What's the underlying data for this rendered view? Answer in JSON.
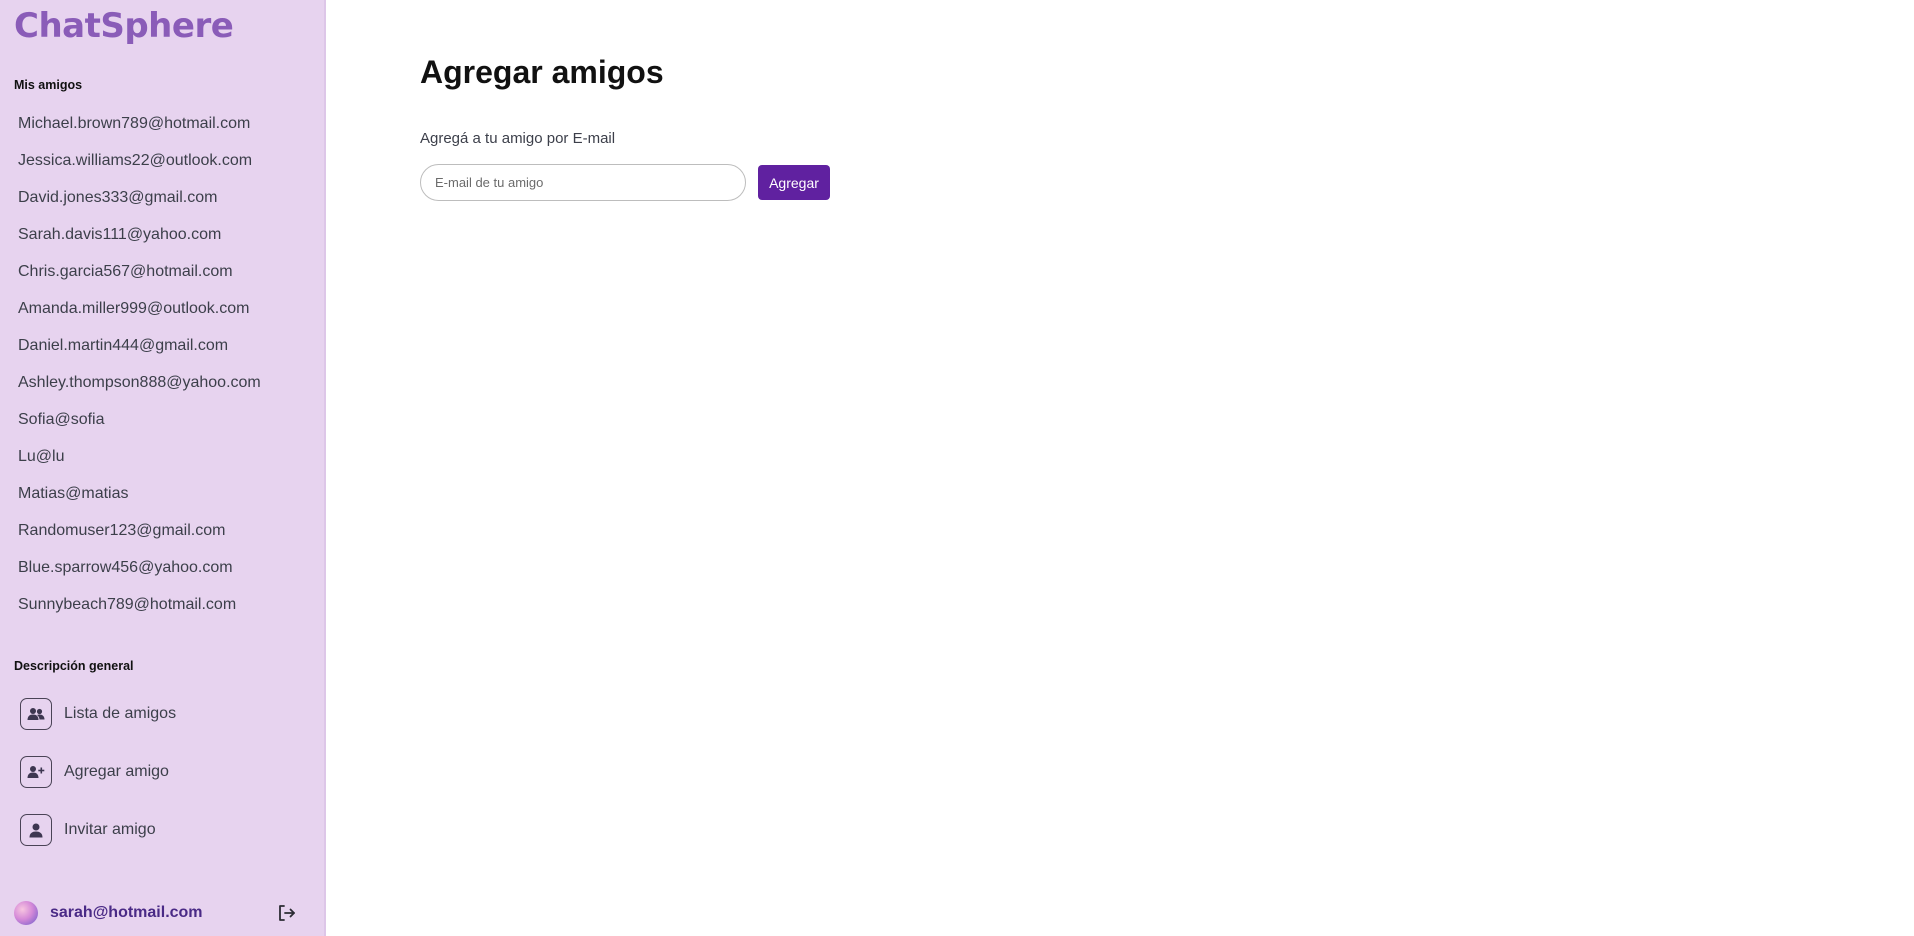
{
  "app": {
    "title": "ChatSphere"
  },
  "sidebar": {
    "friends_heading": "Mis amigos",
    "friends": [
      "Michael.brown789@hotmail.com",
      "Jessica.williams22@outlook.com",
      "David.jones333@gmail.com",
      "Sarah.davis111@yahoo.com",
      "Chris.garcia567@hotmail.com",
      "Amanda.miller999@outlook.com",
      "Daniel.martin444@gmail.com",
      "Ashley.thompson888@yahoo.com",
      "Sofia@sofia",
      "Lu@lu",
      "Matias@matias",
      "Randomuser123@gmail.com",
      "Blue.sparrow456@yahoo.com",
      "Sunnybeach789@hotmail.com"
    ],
    "overview_heading": "Descripción general",
    "nav": [
      {
        "label": "Lista de amigos",
        "icon": "users-icon"
      },
      {
        "label": "Agregar amigo",
        "icon": "user-plus-icon"
      },
      {
        "label": "Invitar amigo",
        "icon": "user-icon"
      }
    ],
    "user": {
      "email": "sarah@hotmail.com"
    }
  },
  "main": {
    "title": "Agregar amigos",
    "subtitle": "Agregá a tu amigo por E-mail",
    "input_placeholder": "E-mail de tu amigo",
    "input_value": "",
    "button_label": "Agregar"
  },
  "colors": {
    "sidebar_bg": "#e7d3ef",
    "logo": "#8a5cb8",
    "accent": "#6021a0",
    "user_email": "#4a2a86"
  }
}
